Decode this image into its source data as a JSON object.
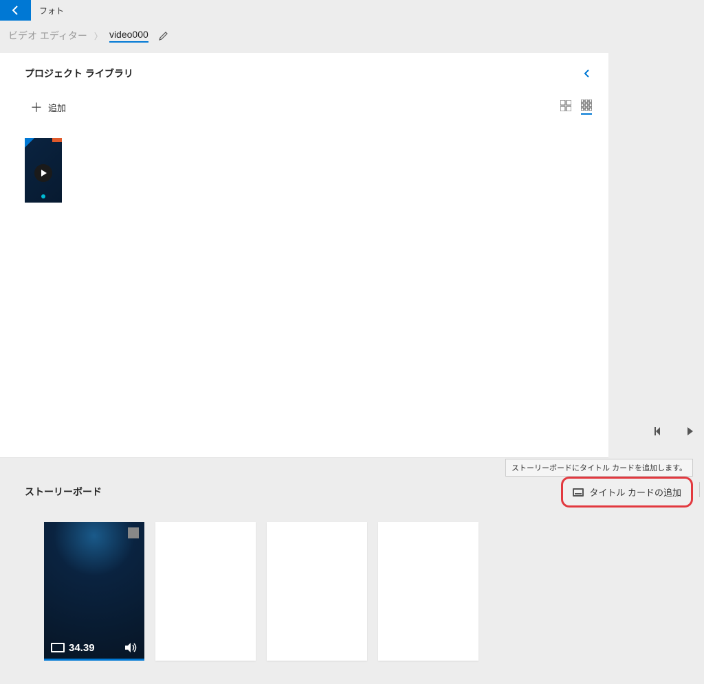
{
  "app": {
    "title": "フォト"
  },
  "breadcrumb": {
    "parent": "ビデオ エディター",
    "current": "video000"
  },
  "library": {
    "title": "プロジェクト ライブラリ",
    "add_label": "追加"
  },
  "storyboard": {
    "title": "ストーリーボード",
    "tooltip": "ストーリーボードにタイトル カードを追加します。",
    "title_card_btn": "タイトル カードの追加",
    "clips": [
      {
        "duration": "34.39",
        "has_audio": true
      }
    ]
  }
}
